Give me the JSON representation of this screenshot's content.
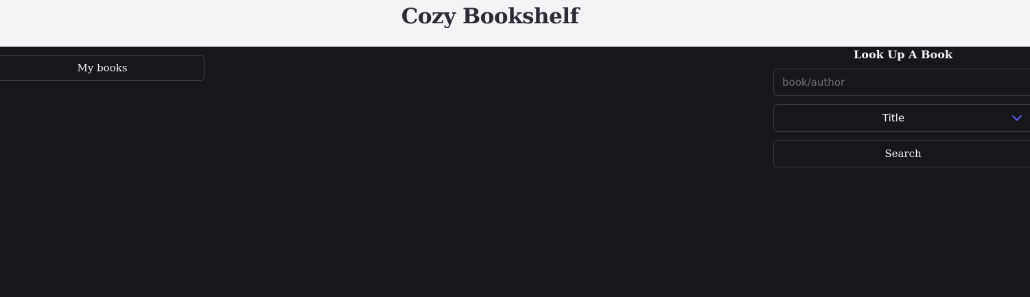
{
  "header": {
    "title": "Cozy Bookshelf"
  },
  "nav": {
    "my_books_label": "My books"
  },
  "lookup": {
    "title": "Look Up A Book",
    "search_placeholder": "book/author",
    "search_value": "",
    "select_value": "Title",
    "search_button_label": "Search"
  },
  "colors": {
    "page_background": "#16171b",
    "header_background": "#f3f4f6",
    "title_text": "#2a2d36",
    "chevron_accent": "#5b5ff0",
    "border": "#3a3c44"
  },
  "icons": {
    "select_icon": "chevron-down-icon"
  }
}
